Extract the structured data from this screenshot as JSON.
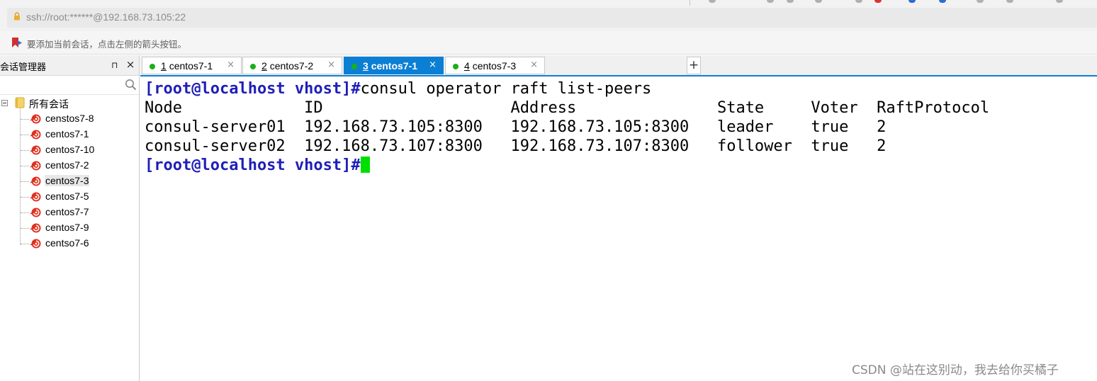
{
  "address_bar": {
    "url": "ssh://root:******@192.168.73.105:22"
  },
  "hint_bar": {
    "text": "要添加当前会话，点击左侧的箭头按钮。"
  },
  "session_manager": {
    "title": "会话管理器",
    "pin_glyph": "⊓",
    "close_glyph": "×",
    "root_label": "所有会话",
    "items": [
      {
        "label": "censtos7-8"
      },
      {
        "label": "centos7-1"
      },
      {
        "label": "centos7-10"
      },
      {
        "label": "centos7-2"
      },
      {
        "label": "centos7-3",
        "selected": true
      },
      {
        "label": "centos7-5"
      },
      {
        "label": "centos7-7"
      },
      {
        "label": "centos7-9"
      },
      {
        "label": "centso7-6"
      }
    ]
  },
  "tabs": [
    {
      "number": "1",
      "name": "centos7-1",
      "active": false
    },
    {
      "number": "2",
      "name": "centos7-2",
      "active": false
    },
    {
      "number": "3",
      "name": "centos7-1",
      "active": true
    },
    {
      "number": "4",
      "name": "centos7-3",
      "active": false
    }
  ],
  "tab_close_glyph": "×",
  "new_tab_glyph": "+",
  "terminal": {
    "prompt": "[root@localhost vhost]#",
    "command": "consul operator raft list-peers",
    "header": "Node             ID                    Address               State     Voter  RaftProtocol",
    "rows": [
      "consul-server01  192.168.73.105:8300   192.168.73.105:8300   leader    true   2",
      "consul-server02  192.168.73.107:8300   192.168.73.107:8300   follower  true   2"
    ]
  },
  "watermark": "CSDN @站在这别动，我去给你买橘子",
  "colors": {
    "accent": "#0b7fd4",
    "prompt": "#1f1fb8",
    "cursor": "#00e000",
    "status_dot": "#19b019"
  }
}
